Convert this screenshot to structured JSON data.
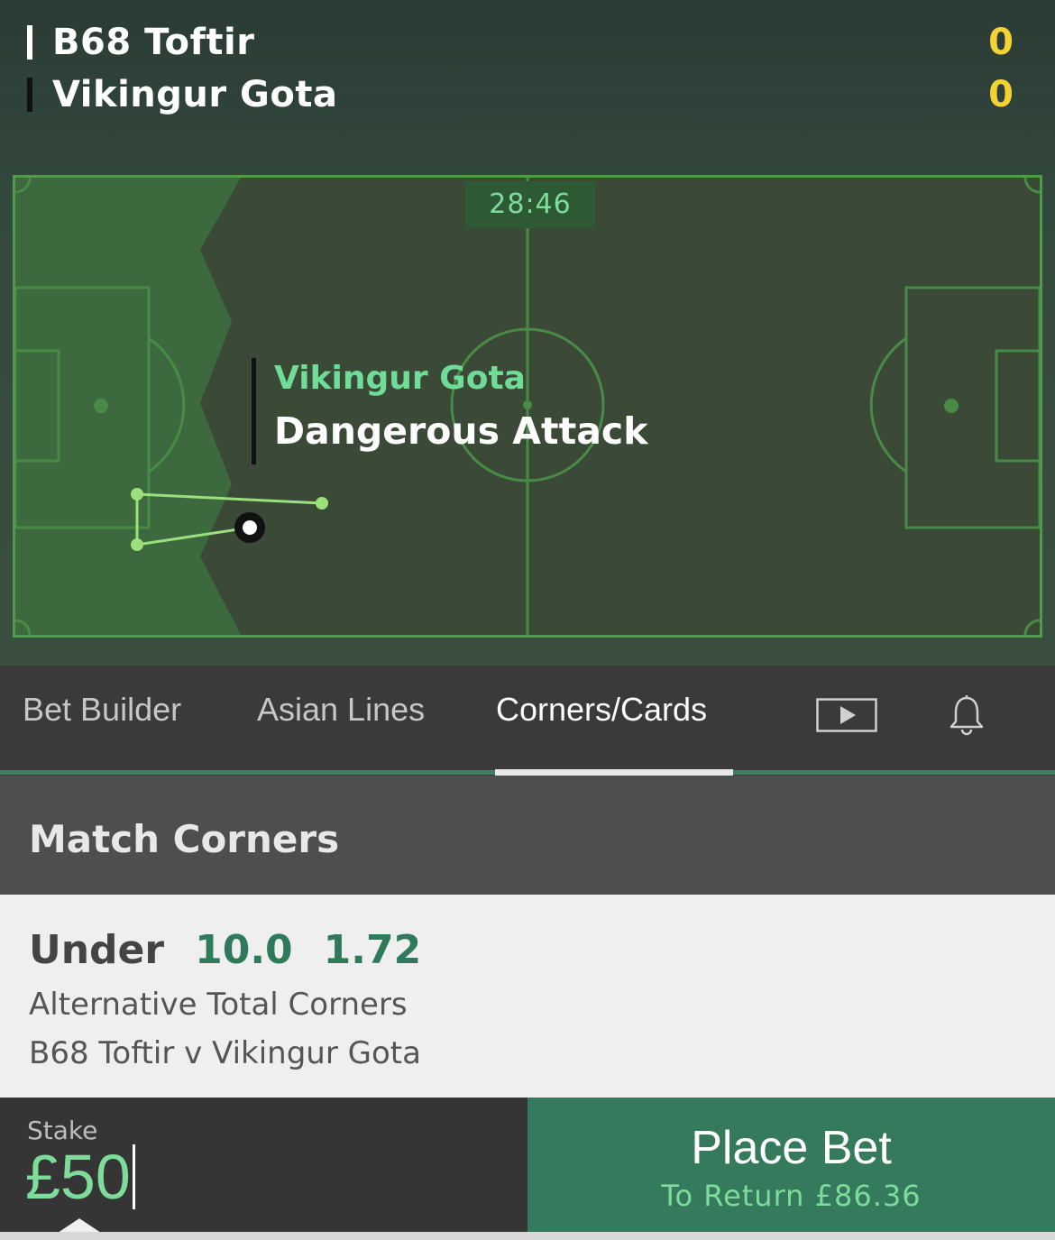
{
  "match": {
    "home": {
      "name": "B68 Toftir",
      "score": "0",
      "color": "#ffffff"
    },
    "away": {
      "name": "Vikingur Gota",
      "score": "0",
      "color": "#111111"
    },
    "clock": "28:46"
  },
  "event": {
    "team": "Vikingur Gota",
    "type": "Dangerous Attack"
  },
  "tabs": [
    {
      "label": "Bet Builder",
      "active": false
    },
    {
      "label": "Asian Lines",
      "active": false
    },
    {
      "label": "Corners/Cards",
      "active": true
    },
    {
      "icon": "play-video-icon"
    },
    {
      "icon": "bell-icon"
    }
  ],
  "section": {
    "title": "Match Corners"
  },
  "selection": {
    "outcome": "Under",
    "line": "10.0",
    "odds": "1.72",
    "market": "Alternative Total Corners",
    "event": "B68 Toftir v Vikingur Gota"
  },
  "betslip": {
    "stake_label": "Stake",
    "stake_value": "£50",
    "place_label": "Place Bet",
    "return_text": "To Return £86.36"
  },
  "colors": {
    "accent": "#7ddc9a",
    "score": "#f3d334",
    "place_bet_bg": "#367a5e"
  }
}
